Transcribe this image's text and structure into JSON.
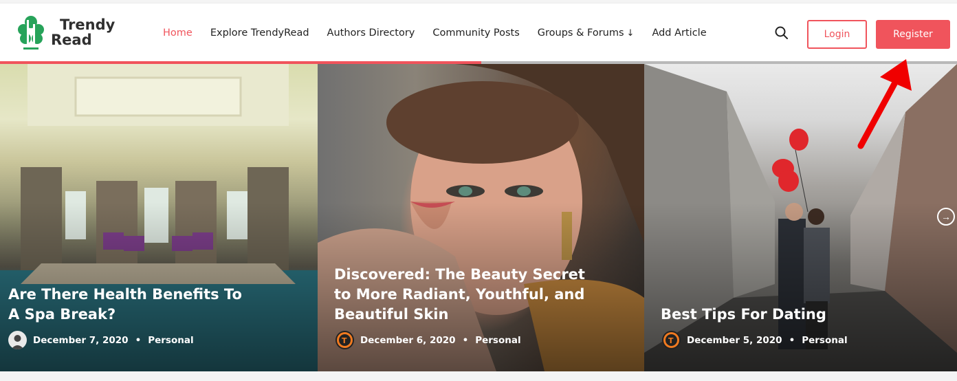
{
  "logo": {
    "line1": "Trendy",
    "line2": "Read"
  },
  "nav": {
    "items": [
      {
        "label": "Home"
      },
      {
        "label": "Explore TrendyRead"
      },
      {
        "label": "Authors Directory"
      },
      {
        "label": "Community Posts"
      },
      {
        "label": "Groups & Forums"
      },
      {
        "label": "Add Article"
      }
    ],
    "dropdown_caret": "↓"
  },
  "header_actions": {
    "login": "Login",
    "register": "Register",
    "search_icon": "search-icon"
  },
  "slider": {
    "progress": 0.503,
    "slides": [
      {
        "title": "Are There Health Benefits To A Spa Break?",
        "date": "December 7, 2020",
        "category": "Personal"
      },
      {
        "title": "Discovered: The Beauty Secret to More Radiant, Youthful, and Beautiful Skin",
        "date": "December 6, 2020",
        "category": "Personal"
      },
      {
        "title": "Best Tips For Dating",
        "date": "December 5, 2020",
        "category": "Personal"
      }
    ],
    "meta_separator": "•",
    "next_icon": "→"
  },
  "colors": {
    "accent": "#f0545c",
    "annotation": "#f00000"
  }
}
